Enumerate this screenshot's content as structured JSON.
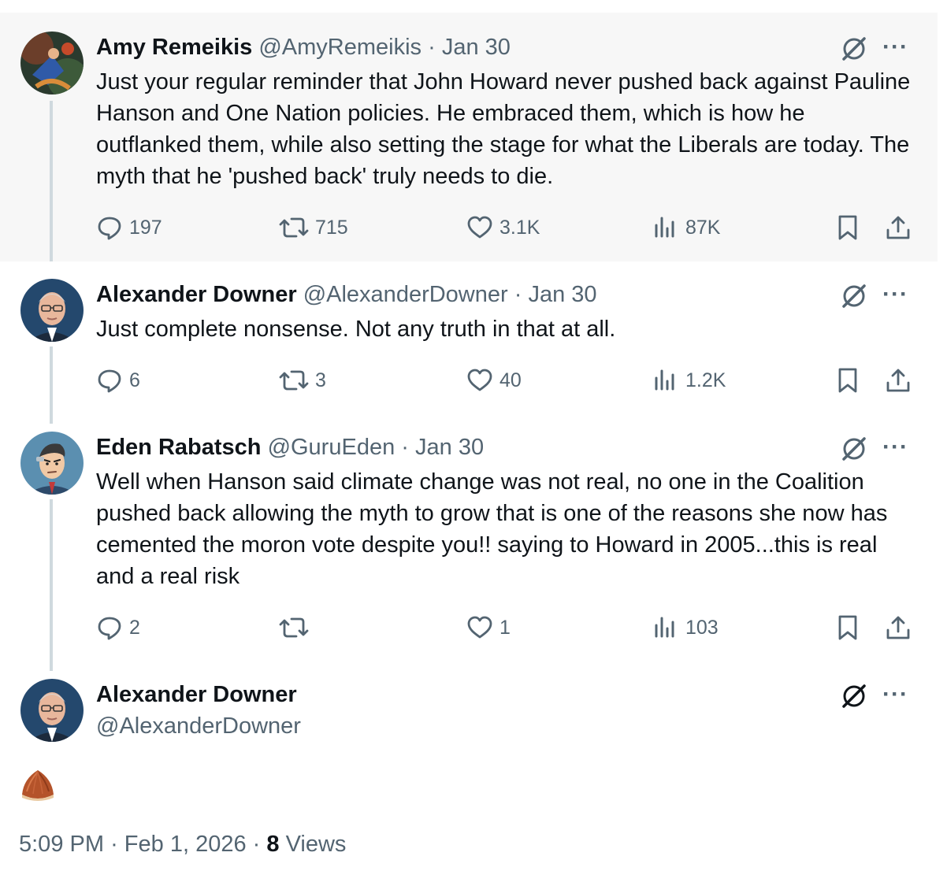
{
  "tweets": [
    {
      "name": "Amy Remeikis",
      "handle": "@AmyRemeikis",
      "separator": "·",
      "date": "Jan 30",
      "text": "Just your regular reminder that John Howard never pushed back against Pauline Hanson and One Nation policies.  He embraced them, which is how he outflanked them, while also setting the stage for what the Liberals  are today.  The myth that he 'pushed back' truly needs to die.",
      "replies": "197",
      "reposts": "715",
      "likes": "3.1K",
      "views": "87K"
    },
    {
      "name": "Alexander Downer",
      "handle": "@AlexanderDowner",
      "separator": "·",
      "date": "Jan 30",
      "text": "Just complete nonsense. Not any truth in that at all.",
      "replies": "6",
      "reposts": "3",
      "likes": "40",
      "views": "1.2K"
    },
    {
      "name": "Eden Rabatsch",
      "handle": "@GuruEden",
      "separator": "·",
      "date": "Jan 30",
      "text": "Well when Hanson said climate change was not real, no one in the Coalition pushed back allowing the myth to grow that is one of the reasons she now has cemented the moron vote despite you!! saying to Howard in 2005...this is real and a real risk",
      "replies": "2",
      "reposts": "",
      "likes": "1",
      "views": "103"
    }
  ],
  "main_tweet": {
    "name": "Alexander Downer",
    "handle": "@AlexanderDowner",
    "emoji_icon": "chestnut-emoji",
    "time": "5:09 PM",
    "sep1": "·",
    "date": "Feb 1, 2026",
    "sep2": "·",
    "views_count": "8",
    "views_label": "Views"
  },
  "more_label": "···",
  "icons": [
    "grok-icon",
    "reply-icon",
    "repost-icon",
    "like-icon",
    "views-icon",
    "bookmark-icon",
    "share-icon"
  ],
  "colors": {
    "text": "#0f1419",
    "muted": "#536471",
    "highlight_bg": "#f7f7f7",
    "thread_line": "#cfd9de"
  }
}
